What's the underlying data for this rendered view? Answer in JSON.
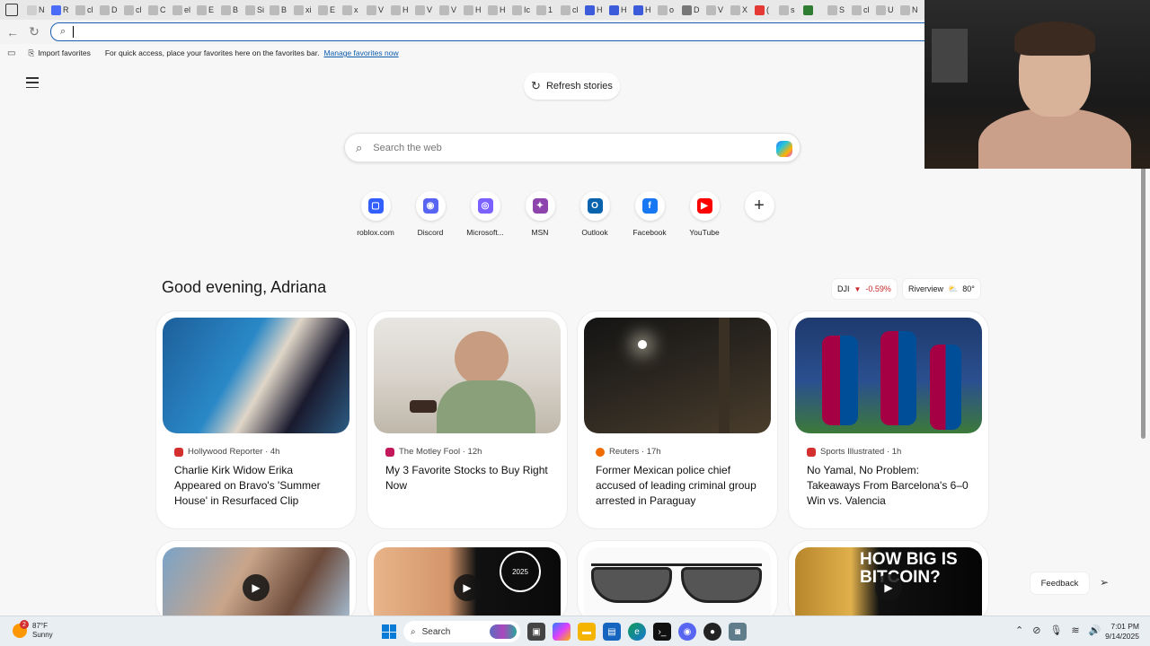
{
  "tabs": [
    {
      "label": "N",
      "color": "#cfcfcf"
    },
    {
      "label": "R",
      "color": "#4a6cf7"
    },
    {
      "label": "cl",
      "color": "#bbbbbb"
    },
    {
      "label": "D",
      "color": "#bbbbbb"
    },
    {
      "label": "cl",
      "color": "#bbbbbb"
    },
    {
      "label": "C",
      "color": "#bbbbbb"
    },
    {
      "label": "el",
      "color": "#bbbbbb"
    },
    {
      "label": "E",
      "color": "#bbbbbb"
    },
    {
      "label": "B",
      "color": "#bbbbbb"
    },
    {
      "label": "Si",
      "color": "#bbbbbb"
    },
    {
      "label": "B",
      "color": "#bbbbbb"
    },
    {
      "label": "xi",
      "color": "#bbbbbb"
    },
    {
      "label": "E",
      "color": "#bbbbbb"
    },
    {
      "label": "x",
      "color": "#bbbbbb"
    },
    {
      "label": "V",
      "color": "#bbbbbb"
    },
    {
      "label": "H",
      "color": "#bbbbbb"
    },
    {
      "label": "V",
      "color": "#bbbbbb"
    },
    {
      "label": "V",
      "color": "#bbbbbb"
    },
    {
      "label": "H",
      "color": "#bbbbbb"
    },
    {
      "label": "H",
      "color": "#bbbbbb"
    },
    {
      "label": "Ic",
      "color": "#bbbbbb"
    },
    {
      "label": "1",
      "color": "#bbbbbb"
    },
    {
      "label": "cl",
      "color": "#bbbbbb"
    },
    {
      "label": "H",
      "color": "#3b5bdb"
    },
    {
      "label": "H",
      "color": "#3b5bdb"
    },
    {
      "label": "H",
      "color": "#3b5bdb"
    },
    {
      "label": "o",
      "color": "#bbbbbb"
    },
    {
      "label": "D",
      "color": "#777777"
    },
    {
      "label": "V",
      "color": "#bbbbbb"
    },
    {
      "label": "X",
      "color": "#bbbbbb"
    },
    {
      "label": "(",
      "color": "#e53935"
    },
    {
      "label": "s",
      "color": "#bbbbbb"
    },
    {
      "label": "",
      "color": "#2e7d32"
    },
    {
      "label": "S",
      "color": "#bbbbbb"
    },
    {
      "label": "cl",
      "color": "#bbbbbb"
    },
    {
      "label": "U",
      "color": "#bbbbbb"
    },
    {
      "label": "N",
      "color": "#bbbbbb"
    }
  ],
  "favorites_bar": {
    "import_label": "Import favorites",
    "hint": "For quick access, place your favorites here on the favorites bar.",
    "manage_link": "Manage favorites now"
  },
  "newtab": {
    "refresh_label": "Refresh stories",
    "search_placeholder": "Search the web",
    "greeting": "Good evening, Adriana",
    "quicklinks": [
      {
        "label": "roblox.com",
        "icon": "roblox-icon",
        "color": "#335fff",
        "glyph": "▢"
      },
      {
        "label": "Discord",
        "icon": "discord-icon",
        "color": "#5865f2",
        "glyph": "◉"
      },
      {
        "label": "Microsoft...",
        "icon": "microsoft-icon",
        "color": "#7b61ff",
        "glyph": "◎"
      },
      {
        "label": "MSN",
        "icon": "msn-icon",
        "color": "#8e44ad",
        "glyph": "✦"
      },
      {
        "label": "Outlook",
        "icon": "outlook-icon",
        "color": "#0a64ad",
        "glyph": "O"
      },
      {
        "label": "Facebook",
        "icon": "facebook-icon",
        "color": "#1877f2",
        "glyph": "f"
      },
      {
        "label": "YouTube",
        "icon": "youtube-icon",
        "color": "#ff0000",
        "glyph": "▶"
      }
    ],
    "add_link_label": "+",
    "market": {
      "symbol": "DJI",
      "change": "-0.59%"
    },
    "weather_pill": {
      "location": "Riverview",
      "temp": "80°"
    },
    "stories": [
      {
        "source": "Hollywood Reporter · 4h",
        "title": "Charlie Kirk Widow Erika Appeared on Bravo's 'Summer House' in Resurfaced Clip",
        "source_color": "#d32f2f"
      },
      {
        "source": "The Motley Fool · 12h",
        "title": "My 3 Favorite Stocks to Buy Right Now",
        "source_color": "#c2185b"
      },
      {
        "source": "Reuters · 17h",
        "title": "Former Mexican police chief accused of leading criminal group arrested in Paraguay",
        "source_color": "#ef6c00"
      },
      {
        "source": "Sports Illustrated · 1h",
        "title": "No Yamal, No Problem: Takeaways From Barcelona's 6–0 Win vs. Valencia",
        "source_color": "#d32f2f"
      }
    ],
    "video_cards": [
      {
        "overlay": ""
      },
      {
        "overlay": "2025"
      },
      {
        "overlay": ""
      },
      {
        "overlay": "HOW BIG IS BITCOIN?"
      }
    ],
    "feedback_label": "Feedback"
  },
  "taskbar": {
    "weather_temp": "87°F",
    "weather_desc": "Sunny",
    "weather_badge": "2",
    "search_label": "Search",
    "time": "7:01 PM",
    "date": "9/14/2025"
  }
}
